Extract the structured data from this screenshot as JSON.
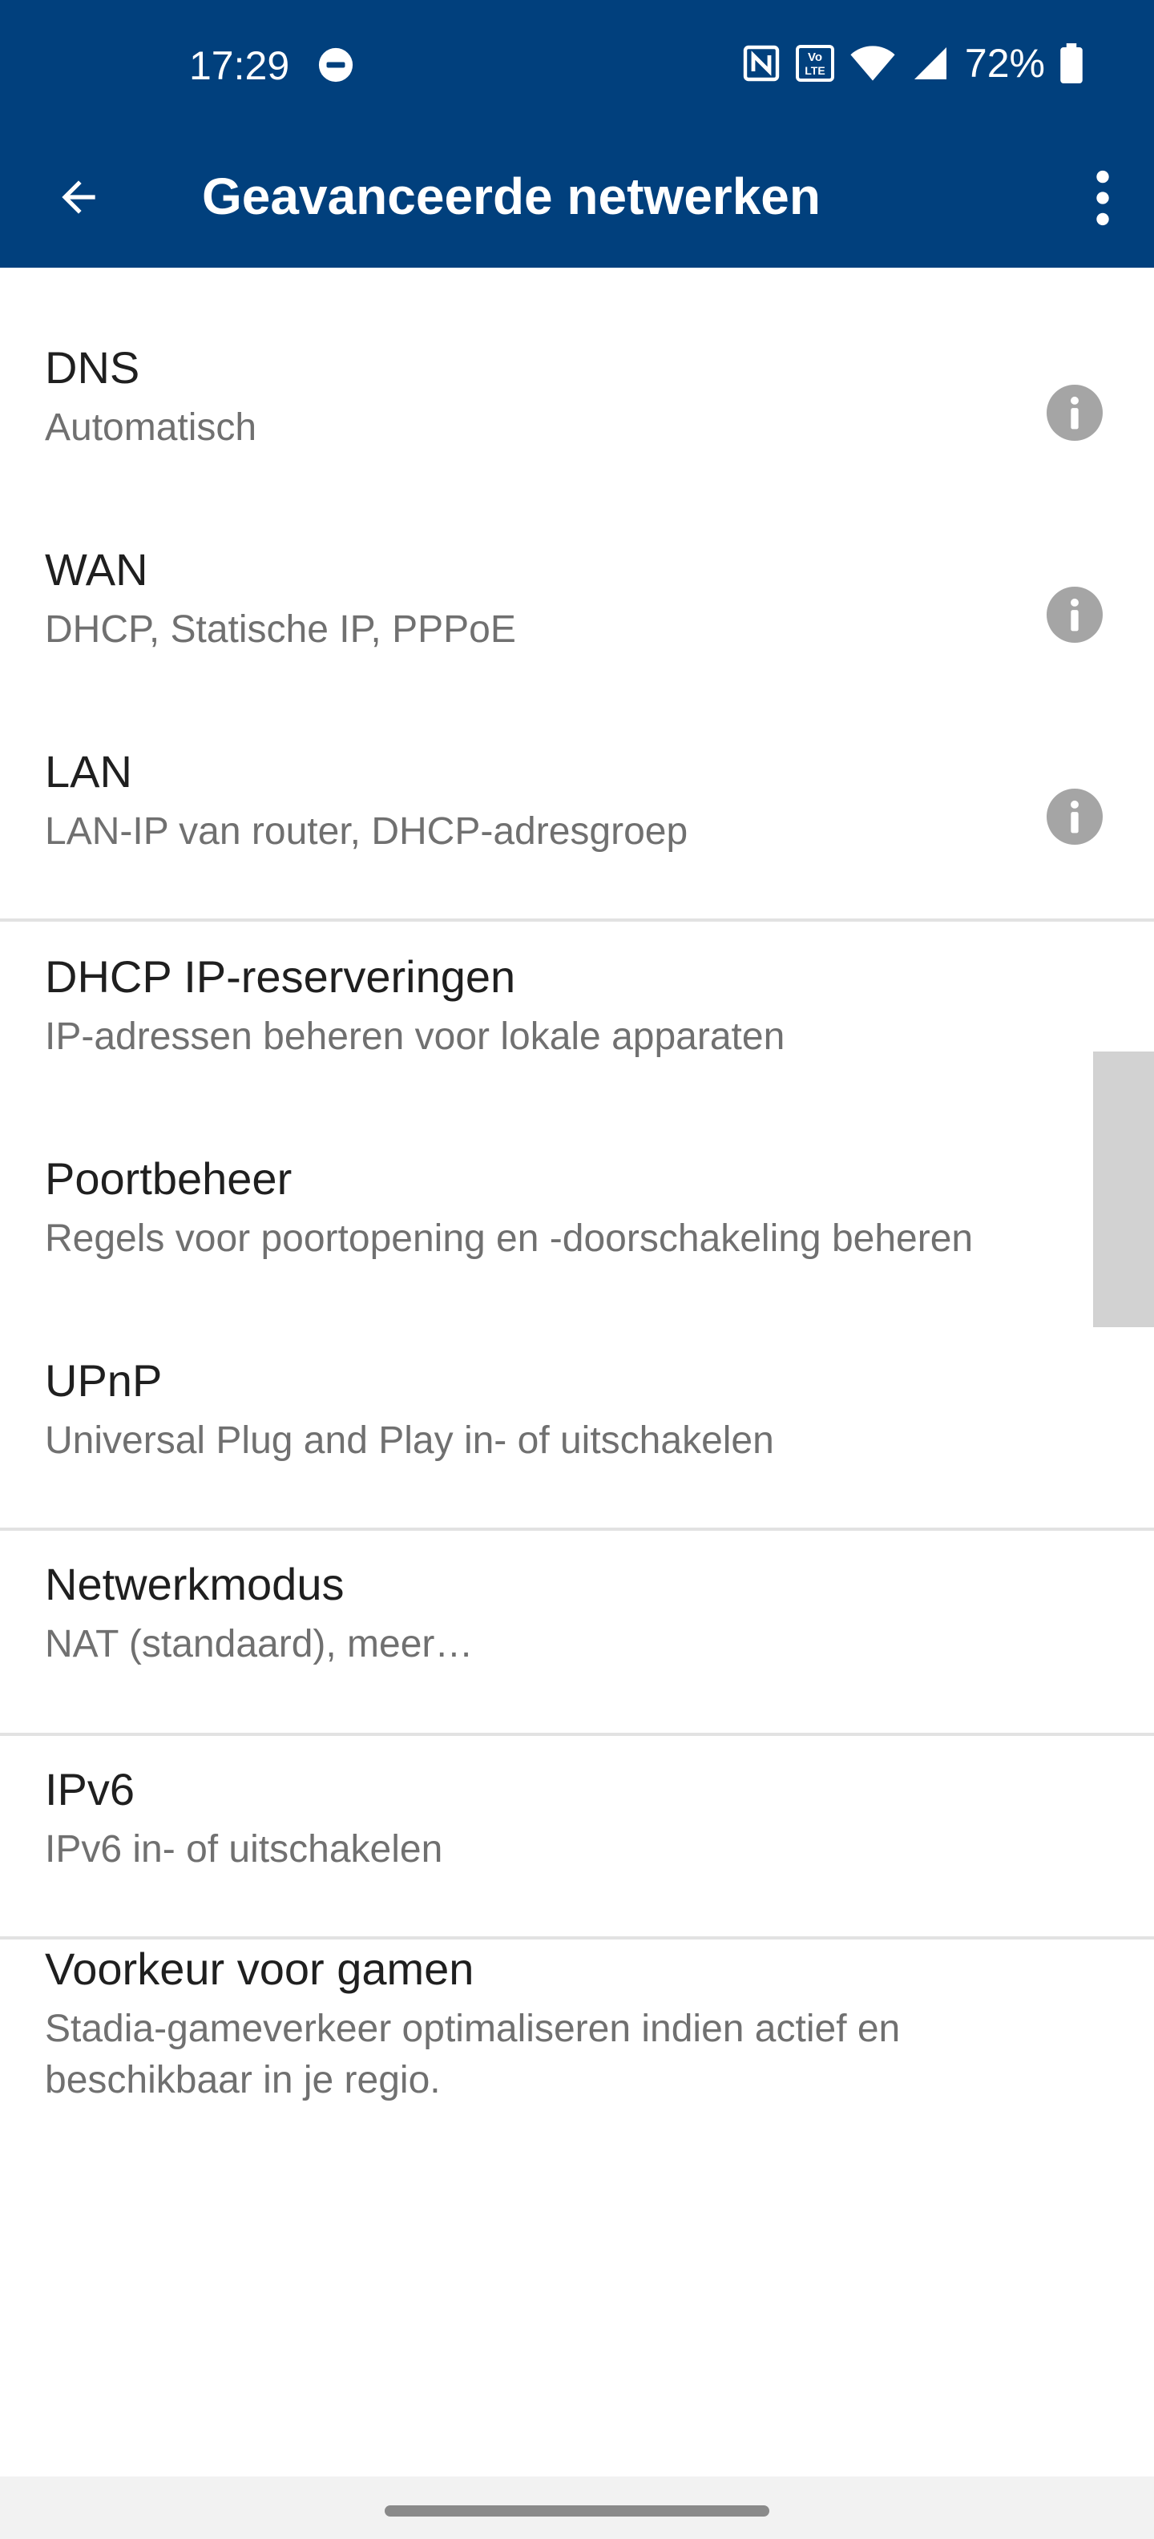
{
  "status_bar": {
    "time": "17:29",
    "battery": "72%",
    "icons": [
      "do-not-disturb-icon",
      "nfc-icon",
      "volte-icon",
      "wifi-icon",
      "cell-signal-icon",
      "battery-icon"
    ]
  },
  "toolbar": {
    "title": "Geavanceerde netwerken",
    "background": "#01407d"
  },
  "items": [
    {
      "title": "DNS",
      "subtitle": "Automatisch",
      "info": true
    },
    {
      "title": "WAN",
      "subtitle": "DHCP, Statische IP, PPPoE",
      "info": true
    },
    {
      "title": "LAN",
      "subtitle": "LAN-IP van router, DHCP-adresgroep",
      "info": true
    },
    {
      "title": "DHCP IP-reserveringen",
      "subtitle": "IP-adressen beheren voor lokale apparaten",
      "info": false
    },
    {
      "title": "Poortbeheer",
      "subtitle": "Regels voor poortopening en -doorschakeling beheren",
      "info": false
    },
    {
      "title": "UPnP",
      "subtitle": "Universal Plug and Play in- of uitschakelen",
      "info": false
    },
    {
      "title": "Netwerkmodus",
      "subtitle": "NAT (standaard), meer…",
      "info": false
    },
    {
      "title": "IPv6",
      "subtitle": "IPv6 in- of uitschakelen",
      "info": false
    },
    {
      "title": "Voorkeur voor gamen",
      "subtitle": "Stadia-gameverkeer optimaliseren indien actief en beschikbaar in je regio.",
      "info": false
    }
  ]
}
